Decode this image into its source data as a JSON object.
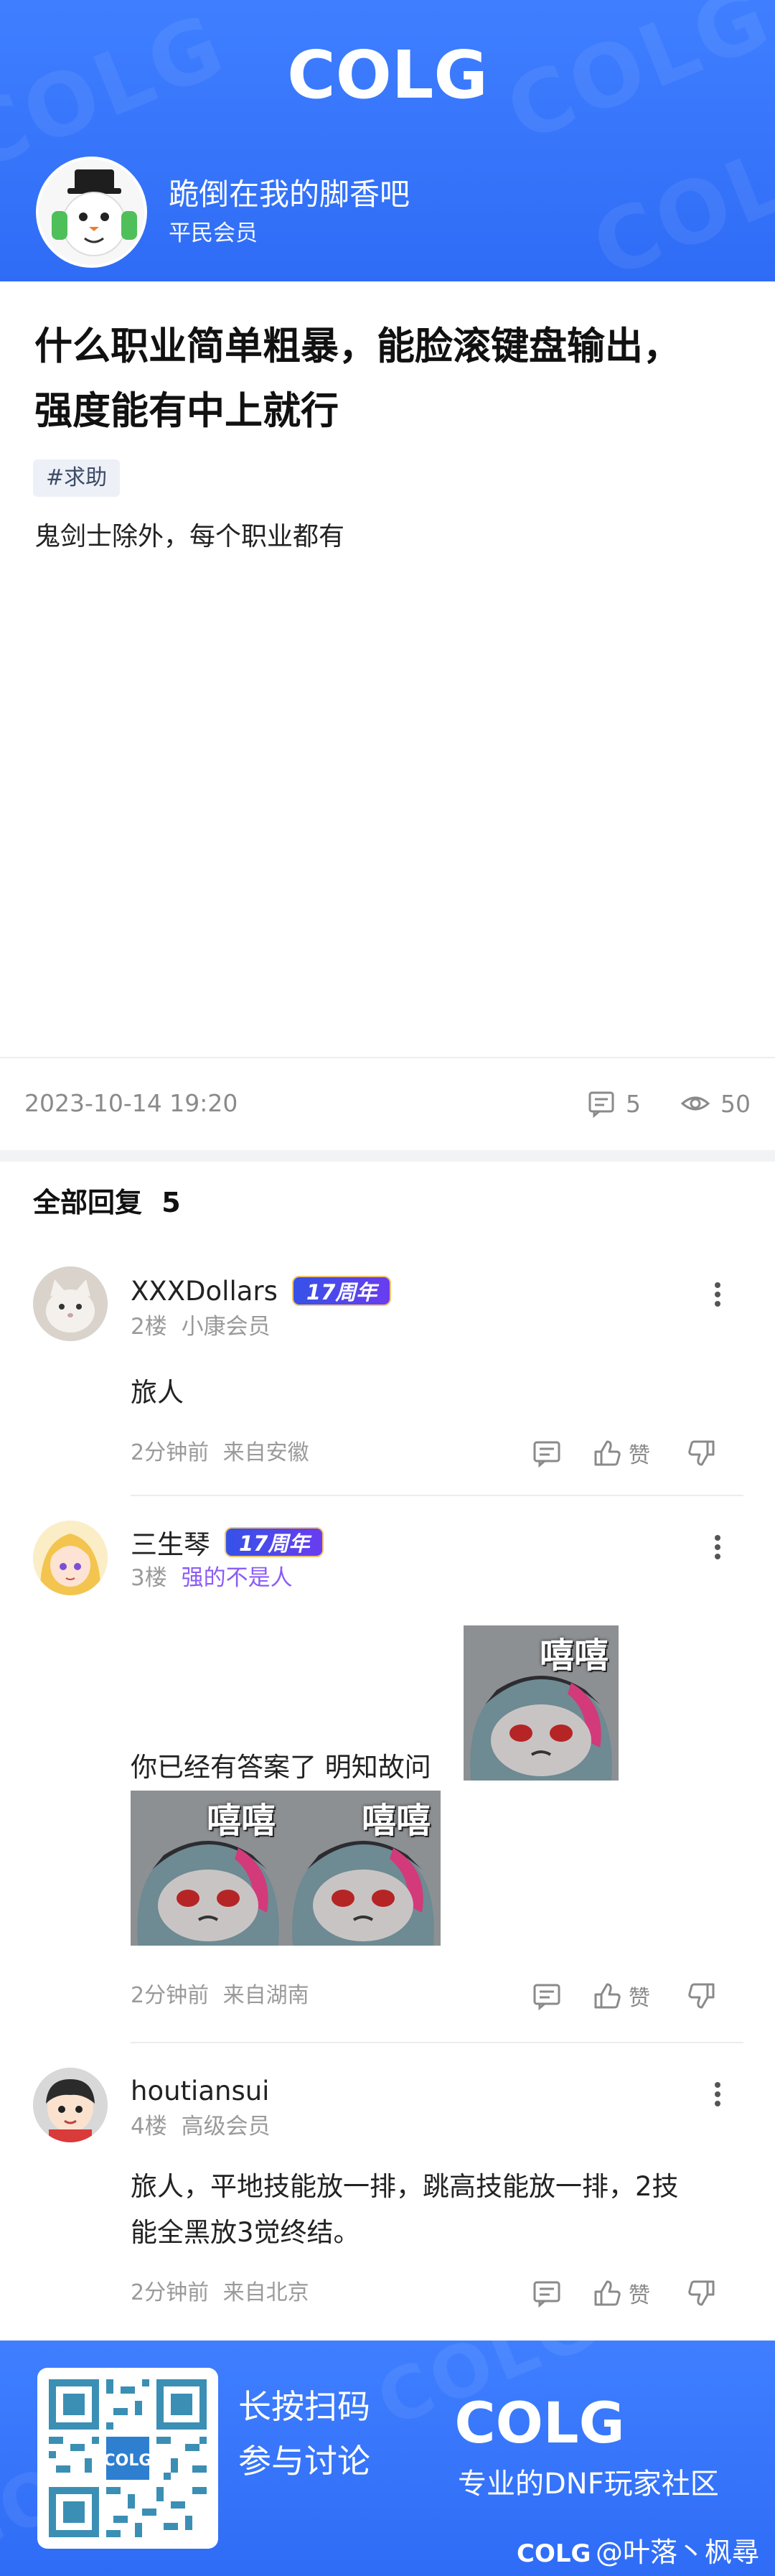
{
  "brand": {
    "logo_text": "COLG"
  },
  "author": {
    "name": "跪倒在我的脚香吧",
    "rank": "平民会员"
  },
  "post": {
    "title_line1": "什么职业简单粗暴，能脸滚键盘输出，",
    "title_line2": "强度能有中上就行",
    "tag": "#求助",
    "body": "鬼剑士除外，每个职业都有",
    "date": "2023-10-14 19:20",
    "comments": "5",
    "views": "50"
  },
  "replies_header": {
    "label": "全部回复",
    "count": "5"
  },
  "replies": [
    {
      "name": "XXXDollars",
      "badge": "17周年",
      "floor": "2楼",
      "rank": "小康会员",
      "text": "旅人",
      "time": "2分钟前",
      "location": "来自安徽",
      "like_label": "赞"
    },
    {
      "name": "三生琴",
      "badge": "17周年",
      "floor": "3楼",
      "rank": "强的不是人",
      "text": "你已经有答案了  明知故问",
      "sticker_caption": "嘻嘻",
      "time": "2分钟前",
      "location": "来自湖南",
      "like_label": "赞"
    },
    {
      "name": "houtiansui",
      "floor": "4楼",
      "rank": "高级会员",
      "text_line1": "旅人，平地技能放一排，跳高技能放一排，2技",
      "text_line2": "能全黑放3觉终结。",
      "time": "2分钟前",
      "location": "来自北京",
      "like_label": "赞"
    }
  ],
  "banner": {
    "line1": "长按扫码",
    "line2": "参与讨论",
    "slogan": "专业的DNF玩家社区",
    "credit": "@叶落丶枫尋",
    "qr_label": "COLG"
  },
  "colors": {
    "brand_blue": "#3577f8",
    "rank_purple": "#8b5cf6",
    "badge_gradient": "#3552e8"
  }
}
